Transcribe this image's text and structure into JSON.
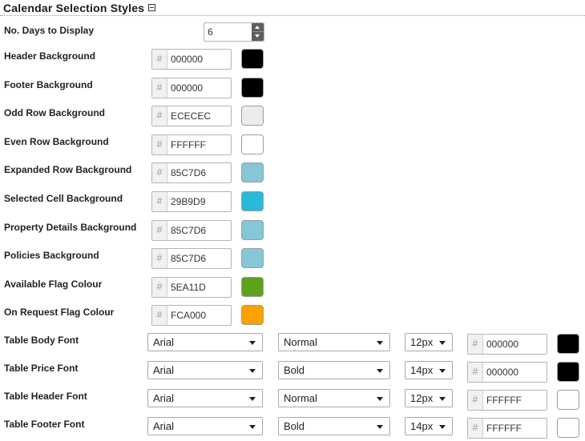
{
  "section": {
    "title": "Calendar Selection Styles"
  },
  "days": {
    "label": "No. Days to Display",
    "value": "6"
  },
  "hex_prefix": "#",
  "colors": [
    {
      "label": "Header Background",
      "hex": "000000",
      "swatch": "#000000"
    },
    {
      "label": "Footer Background",
      "hex": "000000",
      "swatch": "#000000"
    },
    {
      "label": "Odd Row Background",
      "hex": "ECECEC",
      "swatch": "#ECECEC"
    },
    {
      "label": "Even Row Background",
      "hex": "FFFFFF",
      "swatch": "#FFFFFF"
    },
    {
      "label": "Expanded Row Background",
      "hex": "85C7D6",
      "swatch": "#85C7D6"
    },
    {
      "label": "Selected Cell Background",
      "hex": "29B9D9",
      "swatch": "#29B9D9"
    },
    {
      "label": "Property Details Background",
      "hex": "85C7D6",
      "swatch": "#85C7D6"
    },
    {
      "label": "Policies Background",
      "hex": "85C7D6",
      "swatch": "#85C7D6"
    },
    {
      "label": "Available Flag Colour",
      "hex": "5EA11D",
      "swatch": "#5EA11D"
    },
    {
      "label": "On Request Flag Colour",
      "hex": "FCA000",
      "swatch": "#FCA000"
    }
  ],
  "fonts": [
    {
      "label": "Table Body Font",
      "family": "Arial",
      "weight": "Normal",
      "size": "12px",
      "hex": "000000",
      "swatch": "#000000"
    },
    {
      "label": "Table Price Font",
      "family": "Arial",
      "weight": "Bold",
      "size": "14px",
      "hex": "000000",
      "swatch": "#000000"
    },
    {
      "label": "Table Header Font",
      "family": "Arial",
      "weight": "Normal",
      "size": "12px",
      "hex": "FFFFFF",
      "swatch": "#FFFFFF"
    },
    {
      "label": "Table Footer Font",
      "family": "Arial",
      "weight": "Bold",
      "size": "14px",
      "hex": "FFFFFF",
      "swatch": "#FFFFFF"
    }
  ]
}
